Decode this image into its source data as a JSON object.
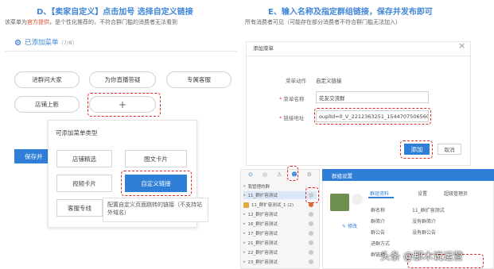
{
  "left": {
    "caption": "D、【卖家自定义】点击加号 选择自定义链接",
    "subtitle_prefix": "该菜单为",
    "subtitle_accent": "官方提供",
    "subtitle_suffix": "，是个性化推荐的，不符合群门槛的消费者无法看到",
    "added_menu_title": "已添加菜单",
    "added_menu_count": "（7/8）",
    "menu_pills": [
      "进群问大家",
      "为你直播答疑",
      "专属客服",
      "店铺上新"
    ],
    "add_symbol": "+",
    "save_button_partial": "保存并",
    "popup": {
      "title": "可添加菜单类型",
      "options": [
        "店铺精选",
        "图文卡片",
        "视频卡片",
        "自定义链接",
        "客服专线"
      ],
      "tooltip": "配置自定义页面跳转的链接（不支持站外域名）"
    }
  },
  "right": {
    "caption": "E、输入名称及指定群组链接，保存并发布即可",
    "subtitle": "所有消费者可见（可能存在部分消费者不符合群门槛无法加入）",
    "dialog": {
      "title": "添加菜单",
      "close_icon": "close-icon",
      "action_label": "菜单动作",
      "action_value": "自定义链接",
      "name_label": "菜单名称",
      "name_value": "花友交流群",
      "link_label": "链接地址",
      "link_value": "ouplId=0_V_2212363251_1544707506560",
      "add_button": "添加",
      "cancel_button": "取消"
    },
    "group_panel": {
      "header": "群组设置",
      "tree_root": "我管理的群",
      "tree_items": [
        "11_群扩容测试",
        "11_群扩容测试_1 (2)",
        "12_群扩容测试",
        "16_群扩容测试",
        "17_群扩容测试",
        "21_群扩容测试",
        "22_群扩容测试",
        "23_群扩容测试"
      ],
      "tabs": [
        "群组资料",
        "设置",
        "超级管理员"
      ],
      "modify_link": "修改",
      "info_labels": [
        "群名称",
        "群简介",
        "群公告",
        "进群方式",
        "群链接"
      ],
      "info_values": [
        "11_群扩容测试",
        "没有群简介",
        "没有群公告",
        "",
        ""
      ]
    }
  },
  "watermark": "头条 @那木说运营",
  "colors": {
    "accent_blue": "#2f7fd8",
    "dash_red": "#e02a2a",
    "caption_blue": "#3f86d8"
  }
}
